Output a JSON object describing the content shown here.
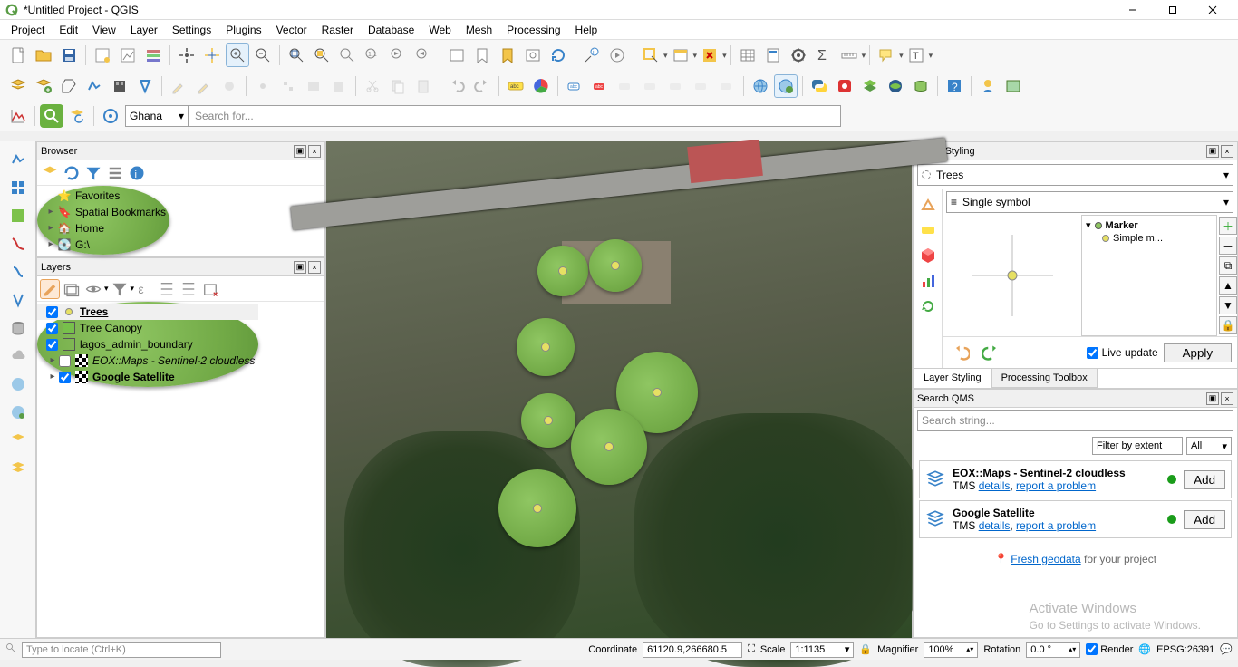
{
  "window": {
    "title": "*Untitled Project - QGIS"
  },
  "menu": [
    "Project",
    "Edit",
    "View",
    "Layer",
    "Settings",
    "Plugins",
    "Vector",
    "Raster",
    "Database",
    "Web",
    "Mesh",
    "Processing",
    "Help"
  ],
  "geocode_region": "Ghana",
  "search_placeholder": "Search for...",
  "browser": {
    "title": "Browser",
    "items": [
      "Favorites",
      "Spatial Bookmarks",
      "Home",
      "G:\\"
    ]
  },
  "layers": {
    "title": "Layers",
    "items": [
      {
        "checked": true,
        "type": "point",
        "label": "Trees",
        "selected": true
      },
      {
        "checked": true,
        "type": "polygon",
        "label": "Tree Canopy"
      },
      {
        "checked": true,
        "type": "polygon_empty",
        "label": "lagos_admin_boundary"
      },
      {
        "checked": false,
        "type": "raster",
        "label": "EOX::Maps - Sentinel-2 cloudless",
        "italic": true
      },
      {
        "checked": true,
        "type": "raster",
        "label": "Google Satellite",
        "bold": true
      }
    ]
  },
  "layer_styling": {
    "title": "Layer Styling",
    "current_layer": "Trees",
    "renderer": "Single symbol",
    "marker_label": "Marker",
    "sublayer_label": "Simple m...",
    "live_update": "Live update",
    "apply": "Apply",
    "tabs": {
      "a": "Layer Styling",
      "b": "Processing Toolbox"
    }
  },
  "qms": {
    "title": "Search QMS",
    "placeholder": "Search string...",
    "filter_extent": "Filter by extent",
    "filter_all": "All",
    "items": [
      {
        "name": "EOX::Maps - Sentinel-2 cloudless",
        "type": "TMS",
        "details": "details",
        "report": "report a problem",
        "add": "Add"
      },
      {
        "name": "Google Satellite",
        "type": "TMS",
        "details": "details",
        "report": "report a problem",
        "add": "Add"
      }
    ],
    "fresh": {
      "link": "Fresh geodata",
      "suffix": " for your project"
    }
  },
  "watermark": {
    "l1": "Activate Windows",
    "l2": "Go to Settings to activate Windows."
  },
  "status": {
    "locate_placeholder": "Type to locate (Ctrl+K)",
    "coord_label": "Coordinate",
    "coord": "61120.9,266680.5",
    "scale_label": "Scale",
    "scale": "1:1135",
    "mag_label": "Magnifier",
    "mag": "100%",
    "rot_label": "Rotation",
    "rot": "0.0 °",
    "render": "Render",
    "crs": "EPSG:26391"
  }
}
